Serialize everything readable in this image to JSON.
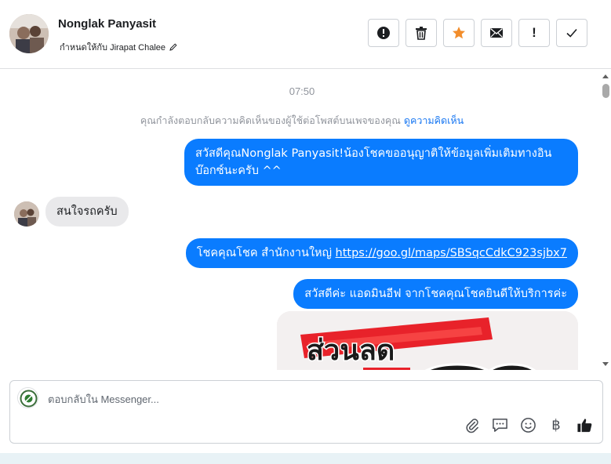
{
  "header": {
    "contact_name": "Nonglak Panyasit",
    "assign_text": "กำหนดให้กับ Jirapat Chalee",
    "toolbar_icons": [
      "alert-circle-icon",
      "trash-icon",
      "star-icon",
      "envelope-icon",
      "exclamation-icon",
      "check-icon"
    ],
    "star_color": "#f28d2b"
  },
  "conversation": {
    "timestamp": "07:50",
    "notice_text": "คุณกำลังตอบกลับความคิดเห็นของผู้ใช้ต่อโพสต์บนเพจของคุณ",
    "notice_link": "ดูความคิดเห็น",
    "messages": [
      {
        "direction": "outgoing",
        "text": "สวัสดีคุณNonglak Panyasit!น้องโชคขออนุญาติให้ข้อมูลเพิ่มเติมทางอินบ๊อกซ์นะครับ ^^"
      },
      {
        "direction": "incoming",
        "text": "สนใจรถครับ"
      },
      {
        "direction": "outgoing",
        "prefix": "โชคคุณโชค สำนักงานใหญ่ ",
        "link": "https://goo.gl/maps/SBSqcCdkC923sjbx7"
      },
      {
        "direction": "outgoing",
        "text": "สวัสดีค่ะ แอดมินอีฟ จากโชคคุณโชคยินดีให้บริการค่ะ"
      }
    ],
    "promo_image_text": "ส่วนลด",
    "bubble_color": "#0a7cff"
  },
  "composer": {
    "placeholder": "ตอบกลับใน Messenger...",
    "tool_icons": [
      "paperclip-icon",
      "saved-reply-icon",
      "emoji-icon",
      "baht-icon",
      "thumbs-up-icon"
    ],
    "baht_symbol": "฿"
  }
}
